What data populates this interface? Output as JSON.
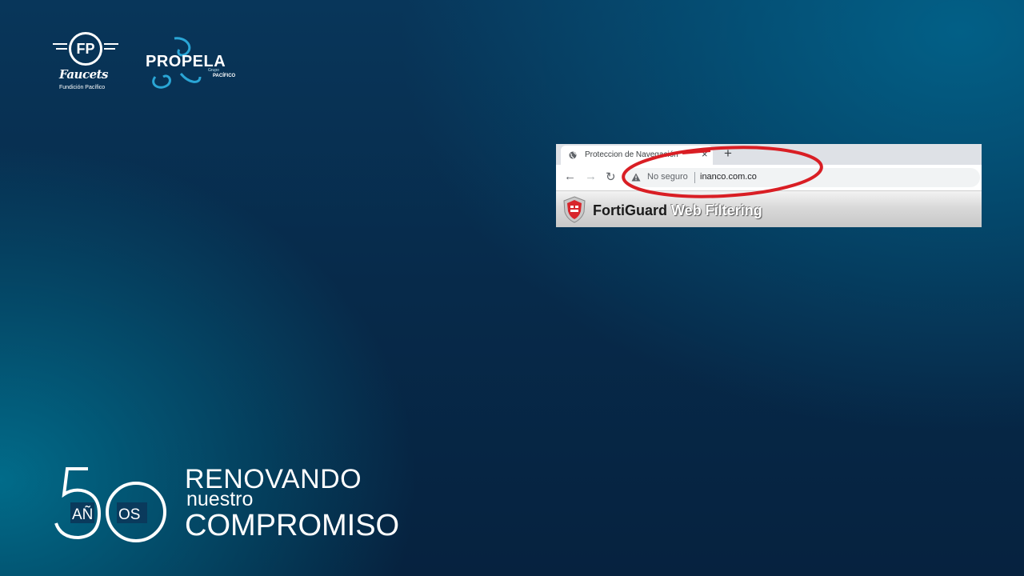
{
  "logos": {
    "fp": {
      "mark": "FP",
      "brand": "Faucets",
      "subtitle": "Fundición Pacífico"
    },
    "propela": {
      "name": "PROPELA",
      "grupo": "Grupo",
      "pacifico": "PACÍFICO"
    }
  },
  "browser": {
    "tab_title": "Proteccion de Navegación",
    "tab_icon": "globe-icon",
    "new_tab": "+",
    "close": "×",
    "security_status": "No seguro",
    "url": "inanco.com.co",
    "page_header": {
      "brand": "FortiGuard",
      "product": "Web Filtering"
    },
    "annotation_color": "#d91e24"
  },
  "anniversary": {
    "number_5": "5",
    "anos": "AÑ",
    "os": "OS",
    "line1": "RENOVANDO",
    "line2": "nuestro",
    "line3": "COMPROMISO"
  }
}
